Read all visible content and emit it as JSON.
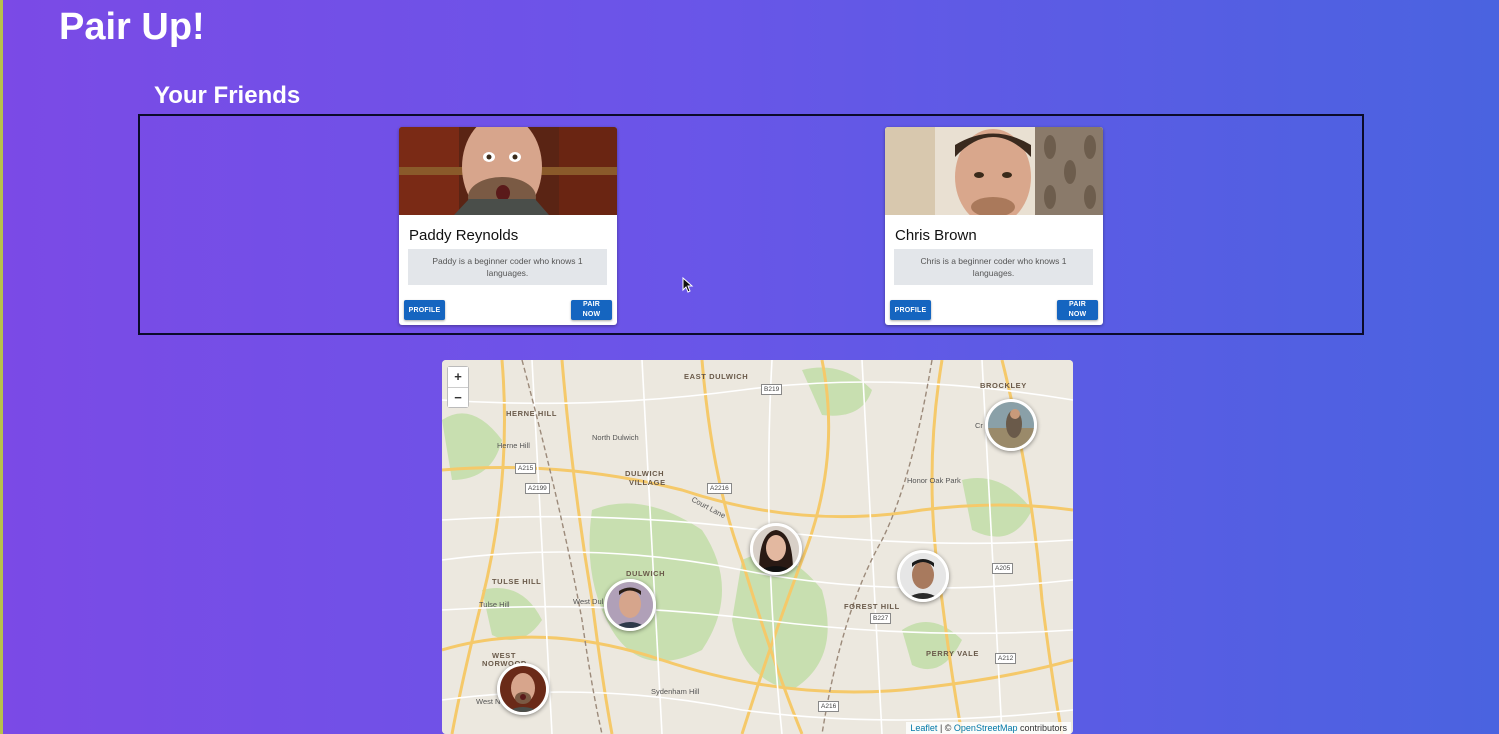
{
  "app": {
    "title": "Pair Up!"
  },
  "friends": {
    "heading": "Your Friends",
    "cards": [
      {
        "name": "Paddy Reynolds",
        "bio": "Paddy is a beginner coder who knows 1 languages.",
        "profile_label": "PROFILE",
        "pair_label_line1": "PAIR",
        "pair_label_line2": "NOW"
      },
      {
        "name": "Chris Brown",
        "bio": "Chris is a beginner coder who knows 1 languages.",
        "profile_label": "PROFILE",
        "pair_label_line1": "PAIR",
        "pair_label_line2": "NOW"
      }
    ]
  },
  "map": {
    "zoom_in": "+",
    "zoom_out": "−",
    "labels": {
      "east_dulwich": "EAST DULWICH",
      "brockley": "BROCKLEY",
      "herne_hill": "HERNE HILL",
      "herne_hill_station": "Herne Hill",
      "north_dulwich": "North Dulwich",
      "dulwich_village_1": "DULWICH",
      "dulwich_village_2": "VILLAGE",
      "honor_oak_park": "Honor Oak Park",
      "court_lane": "Court Lane",
      "tulse_hill": "TULSE HILL",
      "tulse_hill_station": "Tulse Hill",
      "dulwich": "DULWICH",
      "west_dulwich": "West Dul",
      "forest_hill": "FOREST HILL",
      "perry_vale": "PERRY VALE",
      "west_norwood_1": "WEST",
      "west_norwood_2": "NORWOOD",
      "west_norwood_station": "West N",
      "sydenham_hill": "Sydenham Hill",
      "cr": "Cr"
    },
    "roads": [
      "B219",
      "A215",
      "A2199",
      "A2216",
      "A205",
      "B227",
      "A212",
      "A216"
    ],
    "attribution": {
      "leaflet": "Leaflet",
      "sep": " | © ",
      "osm": "OpenStreetMap",
      "suffix": " contributors"
    }
  }
}
